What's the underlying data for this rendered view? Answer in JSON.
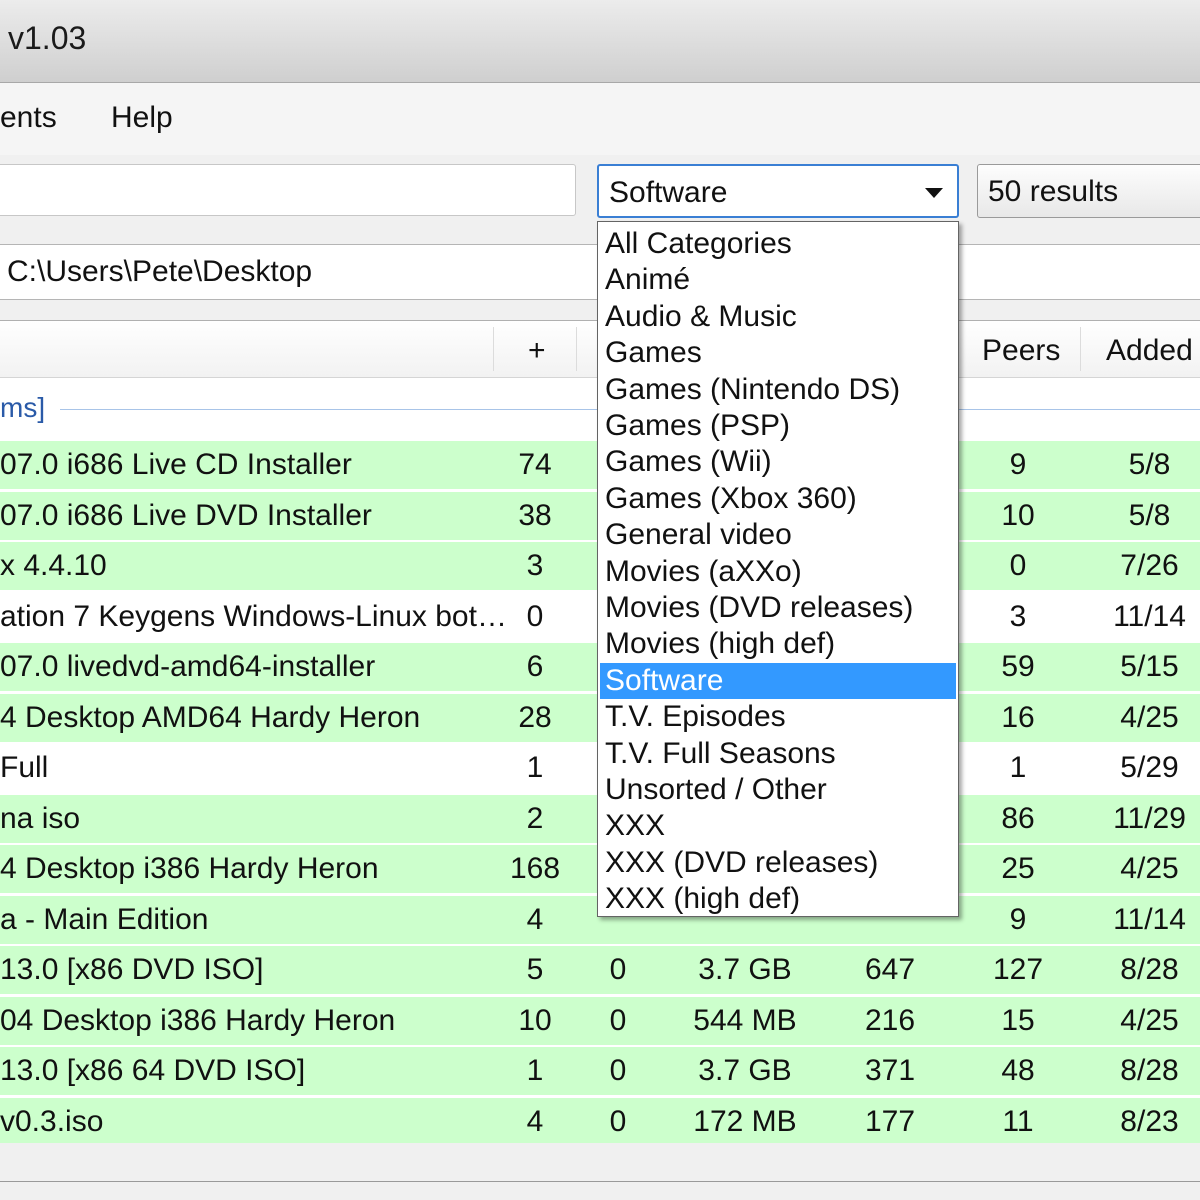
{
  "window": {
    "title": "v1.03"
  },
  "menu": {
    "items": [
      "ents",
      "Help"
    ]
  },
  "toolbar": {
    "category": "Software",
    "results": "50 results",
    "path": "C:\\Users\\Pete\\Desktop"
  },
  "table": {
    "columns": {
      "plus": "+",
      "peers": "Peers",
      "added": "Added"
    },
    "group": "ms]",
    "rows": [
      {
        "name": "07.0 i686 Live CD Installer",
        "plus": "74",
        "minus": "",
        "size": "",
        "seeds": "",
        "peers": "9",
        "added": "5/8",
        "color": "green"
      },
      {
        "name": "07.0 i686 Live DVD Installer",
        "plus": "38",
        "minus": "",
        "size": "",
        "seeds": "",
        "peers": "10",
        "added": "5/8",
        "color": "green"
      },
      {
        "name": "x 4.4.10",
        "plus": "3",
        "minus": "",
        "size": "",
        "seeds": "",
        "peers": "0",
        "added": "7/26",
        "color": "green"
      },
      {
        "name": "ation 7 Keygens Windows-Linux bot…",
        "plus": "0",
        "minus": "",
        "size": "",
        "seeds": "",
        "peers": "3",
        "added": "11/14",
        "color": "white"
      },
      {
        "name": "07.0 livedvd-amd64-installer",
        "plus": "6",
        "minus": "",
        "size": "",
        "seeds": "",
        "peers": "59",
        "added": "5/15",
        "color": "green"
      },
      {
        "name": "4 Desktop AMD64 Hardy Heron",
        "plus": "28",
        "minus": "",
        "size": "",
        "seeds": "",
        "peers": "16",
        "added": "4/25",
        "color": "green"
      },
      {
        "name": "Full",
        "plus": "1",
        "minus": "",
        "size": "",
        "seeds": "",
        "peers": "1",
        "added": "5/29",
        "color": "white"
      },
      {
        "name": "na iso",
        "plus": "2",
        "minus": "",
        "size": "",
        "seeds": "",
        "peers": "86",
        "added": "11/29",
        "color": "green"
      },
      {
        "name": "4 Desktop i386 Hardy Heron",
        "plus": "168",
        "minus": "",
        "size": "",
        "seeds": "",
        "peers": "25",
        "added": "4/25",
        "color": "green"
      },
      {
        "name": "a - Main Edition",
        "plus": "4",
        "minus": "",
        "size": "",
        "seeds": "",
        "peers": "9",
        "added": "11/14",
        "color": "green"
      },
      {
        "name": "13.0 [x86 DVD ISO]",
        "plus": "5",
        "minus": "0",
        "size": "3.7 GB",
        "seeds": "647",
        "peers": "127",
        "added": "8/28",
        "color": "green"
      },
      {
        "name": "04 Desktop i386 Hardy Heron",
        "plus": "10",
        "minus": "0",
        "size": "544 MB",
        "seeds": "216",
        "peers": "15",
        "added": "4/25",
        "color": "green"
      },
      {
        "name": "13.0 [x86 64 DVD ISO]",
        "plus": "1",
        "minus": "0",
        "size": "3.7 GB",
        "seeds": "371",
        "peers": "48",
        "added": "8/28",
        "color": "green"
      },
      {
        "name": "v0.3.iso",
        "plus": "4",
        "minus": "0",
        "size": "172 MB",
        "seeds": "177",
        "peers": "11",
        "added": "8/23",
        "color": "green"
      }
    ]
  },
  "dropdown": {
    "options": [
      "All Categories",
      "Animé",
      "Audio & Music",
      "Games",
      "Games (Nintendo DS)",
      "Games (PSP)",
      "Games (Wii)",
      "Games (Xbox 360)",
      "General video",
      "Movies (aXXo)",
      "Movies (DVD releases)",
      "Movies (high def)",
      "Software",
      "T.V. Episodes",
      "T.V. Full Seasons",
      "Unsorted / Other",
      "XXX",
      "XXX (DVD releases)",
      "XXX (high def)"
    ],
    "selected_index": 12
  },
  "colors": {
    "row_green": "#ccffcc",
    "selection": "#3399ff",
    "focus_border": "#3a7fd4"
  }
}
